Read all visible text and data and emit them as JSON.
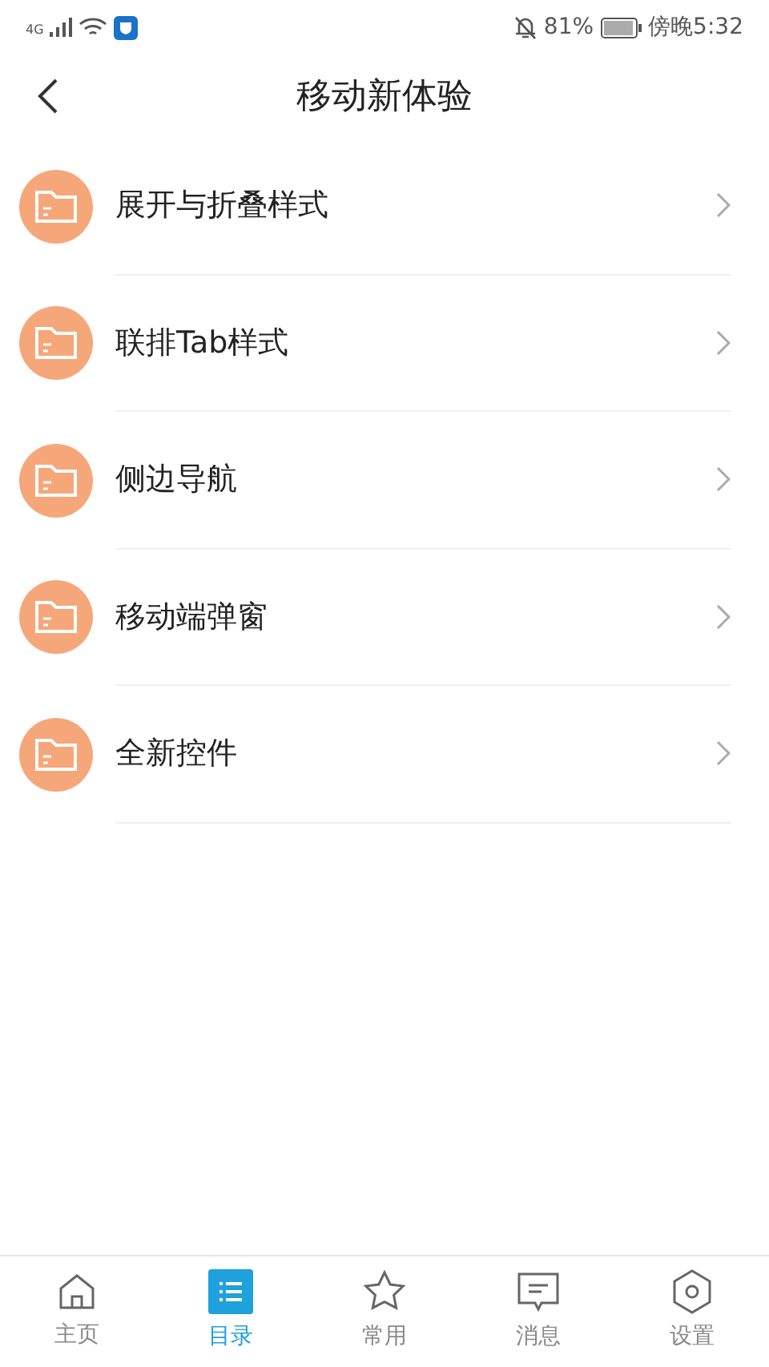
{
  "status_bar": {
    "network": "4G",
    "battery": "81%",
    "time": "傍晚5:32"
  },
  "header": {
    "title": "移动新体验"
  },
  "items": [
    {
      "label": "展开与折叠样式"
    },
    {
      "label": "联排Tab样式"
    },
    {
      "label": "侧边导航"
    },
    {
      "label": "移动端弹窗"
    },
    {
      "label": "全新控件"
    }
  ],
  "tabs": [
    {
      "kind": "home",
      "label": "主页",
      "selected": false
    },
    {
      "kind": "list",
      "label": "目录",
      "selected": true
    },
    {
      "kind": "star",
      "label": "常用",
      "selected": false
    },
    {
      "kind": "message",
      "label": "消息",
      "selected": false
    },
    {
      "kind": "settings",
      "label": "设置",
      "selected": false
    }
  ]
}
